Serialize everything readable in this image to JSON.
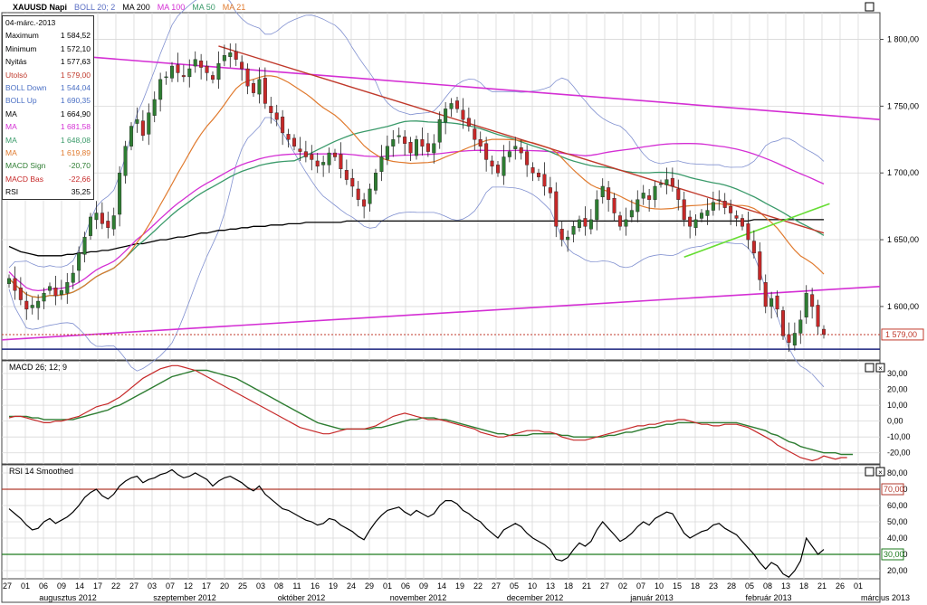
{
  "header": {
    "symbol": "XAUUSD Napi",
    "indicators": [
      {
        "label": "BOLL 20; 2",
        "color": "#5b6fc4"
      },
      {
        "label": "MA 200",
        "color": "#000000"
      },
      {
        "label": "MA 100",
        "color": "#d42fd4"
      },
      {
        "label": "MA 50",
        "color": "#3a9a6a"
      },
      {
        "label": "MA 21",
        "color": "#e07a2e"
      }
    ]
  },
  "info_box": {
    "date": "04-márc.-2013",
    "rows": [
      {
        "label": "Maximum",
        "value": "1 584,52",
        "color": "#000000"
      },
      {
        "label": "Minimum",
        "value": "1 572,10",
        "color": "#000000"
      },
      {
        "label": "Nyitás",
        "value": "1 577,63",
        "color": "#000000"
      },
      {
        "label": "Utolsó",
        "value": "1 579,00",
        "color": "#c0392b"
      },
      {
        "label": "BOLL Down",
        "value": "1 544,04",
        "color": "#4a6fc4"
      },
      {
        "label": "BOLL Up",
        "value": "1 690,35",
        "color": "#4a6fc4"
      },
      {
        "label": "MA",
        "value": "1 664,90",
        "color": "#000000"
      },
      {
        "label": "MA",
        "value": "1 681,58",
        "color": "#d42fd4"
      },
      {
        "label": "MA",
        "value": "1 648,08",
        "color": "#3a9a6a"
      },
      {
        "label": "MA",
        "value": "1 619,89",
        "color": "#e07a2e"
      },
      {
        "label": "MACD Sign",
        "value": "-20,70",
        "color": "#2e7d32"
      },
      {
        "label": "MACD Bas",
        "value": "-22,66",
        "color": "#c62828"
      },
      {
        "label": "RSI",
        "value": "35,25",
        "color": "#000000"
      }
    ]
  },
  "colors": {
    "up": "#2e7d32",
    "down": "#c62828",
    "ma200": "#000000",
    "ma100": "#d42fd4",
    "ma50": "#3a9a6a",
    "ma21": "#e07a2e",
    "boll": "#8090d0",
    "grid": "#d8d8d8",
    "trend_red": "#c0392b",
    "trend_green": "#66dd33",
    "support_blue": "#1a237e",
    "price_dotted": "#c0392b",
    "rsi_level_high": "#b03a2e",
    "rsi_level_low": "#1e7b1e"
  },
  "chart_data": [
    {
      "type": "candlestick",
      "title": "XAUUSD Napi",
      "ylim": [
        1560,
        1820
      ],
      "y_ticks": [
        "1 800,00",
        "1 750,00",
        "1 700,00",
        "1 650,00",
        "1 600,00"
      ],
      "last_price_label": "1 579,00",
      "x_date_labels": [
        "27",
        "01",
        "06",
        "09",
        "14",
        "17",
        "22",
        "27",
        "03",
        "07",
        "12",
        "17",
        "20",
        "25",
        "03",
        "08",
        "11",
        "16",
        "19",
        "24",
        "29",
        "01",
        "06",
        "09",
        "14",
        "19",
        "22",
        "27",
        "05",
        "10",
        "13",
        "18",
        "21",
        "27",
        "02",
        "07",
        "10",
        "15",
        "18",
        "23",
        "28",
        "05",
        "08",
        "13",
        "18",
        "21",
        "26",
        "01"
      ],
      "month_labels": [
        "augusztus 2012",
        "szeptember 2012",
        "október 2012",
        "november 2012",
        "december 2012",
        "január 2013",
        "február 2013",
        "március 2013"
      ],
      "close": [
        1621,
        1612,
        1605,
        1598,
        1601,
        1604,
        1610,
        1615,
        1608,
        1612,
        1618,
        1625,
        1640,
        1652,
        1667,
        1670,
        1662,
        1659,
        1668,
        1700,
        1720,
        1735,
        1740,
        1728,
        1745,
        1755,
        1770,
        1772,
        1780,
        1775,
        1772,
        1778,
        1785,
        1779,
        1775,
        1770,
        1782,
        1788,
        1790,
        1785,
        1778,
        1765,
        1760,
        1770,
        1752,
        1745,
        1740,
        1730,
        1725,
        1720,
        1716,
        1712,
        1710,
        1705,
        1708,
        1715,
        1712,
        1703,
        1695,
        1690,
        1680,
        1675,
        1688,
        1700,
        1712,
        1720,
        1725,
        1728,
        1722,
        1715,
        1725,
        1720,
        1716,
        1722,
        1740,
        1748,
        1752,
        1748,
        1740,
        1735,
        1725,
        1720,
        1710,
        1705,
        1700,
        1712,
        1716,
        1720,
        1715,
        1706,
        1700,
        1697,
        1690,
        1685,
        1660,
        1650,
        1652,
        1660,
        1665,
        1660,
        1665,
        1680,
        1690,
        1680,
        1670,
        1660,
        1665,
        1672,
        1680,
        1685,
        1680,
        1690,
        1692,
        1695,
        1690,
        1680,
        1665,
        1660,
        1665,
        1670,
        1672,
        1678,
        1680,
        1674,
        1670,
        1666,
        1660,
        1650,
        1640,
        1620,
        1600,
        1606,
        1598,
        1578,
        1573,
        1580,
        1590,
        1610,
        1600,
        1585,
        1579
      ],
      "ma200": [
        1645,
        1643,
        1641,
        1640,
        1639,
        1638,
        1638,
        1638,
        1638,
        1638,
        1639,
        1639,
        1640,
        1640,
        1641,
        1641,
        1642,
        1642,
        1643,
        1644,
        1645,
        1646,
        1647,
        1647,
        1648,
        1649,
        1650,
        1650,
        1651,
        1652,
        1652,
        1653,
        1654,
        1655,
        1655,
        1656,
        1657,
        1657,
        1658,
        1658,
        1659,
        1659,
        1660,
        1660,
        1660,
        1661,
        1661,
        1661,
        1662,
        1662,
        1662,
        1663,
        1663,
        1663,
        1663,
        1663,
        1663,
        1663,
        1664,
        1664,
        1664,
        1664,
        1664,
        1664,
        1664,
        1664,
        1664,
        1664,
        1664,
        1664,
        1664,
        1664,
        1664,
        1664,
        1664,
        1664,
        1664,
        1664,
        1664,
        1664,
        1664,
        1664,
        1664,
        1664,
        1664,
        1664,
        1664,
        1664,
        1664,
        1664,
        1664,
        1664,
        1664,
        1664,
        1664,
        1664,
        1664,
        1664,
        1664,
        1664,
        1664,
        1664,
        1664,
        1664,
        1664,
        1664,
        1664,
        1664,
        1664,
        1664,
        1664,
        1664,
        1664,
        1664,
        1664,
        1664,
        1664,
        1664,
        1664,
        1664,
        1664,
        1664,
        1664,
        1664,
        1664,
        1664,
        1664,
        1664,
        1665,
        1665,
        1665,
        1665,
        1665,
        1665,
        1665,
        1665,
        1665,
        1665,
        1665,
        1665,
        1665
      ]
    },
    {
      "type": "line",
      "title": "MACD 26; 12; 9",
      "ylim": [
        -27,
        38
      ],
      "y_ticks": [
        "30,00",
        "20,00",
        "10,00",
        "0,00",
        "-10,00",
        "-20,00"
      ],
      "series": [
        {
          "name": "MACD Bas",
          "values": [
            2,
            3,
            3,
            2,
            1,
            0,
            -1,
            -1,
            0,
            0,
            1,
            2,
            3,
            5,
            7,
            9,
            10,
            11,
            13,
            15,
            18,
            21,
            24,
            27,
            29,
            31,
            33,
            34,
            35,
            35,
            34,
            33,
            32,
            30,
            28,
            26,
            24,
            22,
            20,
            18,
            16,
            14,
            12,
            10,
            8,
            6,
            4,
            2,
            0,
            -2,
            -4,
            -5,
            -6,
            -7,
            -8,
            -8,
            -7,
            -6,
            -5,
            -5,
            -5,
            -5,
            -4,
            -3,
            -1,
            1,
            3,
            4,
            5,
            4,
            3,
            2,
            1,
            1,
            1,
            0,
            -1,
            -2,
            -3,
            -4,
            -5,
            -7,
            -8,
            -9,
            -10,
            -10,
            -9,
            -8,
            -7,
            -6,
            -6,
            -6,
            -7,
            -7,
            -8,
            -10,
            -11,
            -12,
            -12,
            -12,
            -11,
            -10,
            -9,
            -8,
            -7,
            -6,
            -5,
            -4,
            -3,
            -3,
            -2,
            -2,
            -1,
            0,
            0,
            1,
            1,
            0,
            -1,
            -2,
            -2,
            -3,
            -3,
            -2,
            -2,
            -2,
            -3,
            -4,
            -6,
            -8,
            -10,
            -12,
            -15,
            -17,
            -19,
            -21,
            -23,
            -24,
            -25,
            -24,
            -22,
            -23,
            -24,
            -23,
            -23
          ]
        },
        {
          "name": "MACD Sign",
          "values": [
            3,
            3,
            3,
            3,
            2,
            2,
            1,
            1,
            1,
            1,
            1,
            1,
            2,
            3,
            4,
            5,
            6,
            7,
            9,
            10,
            12,
            14,
            16,
            18,
            20,
            22,
            24,
            26,
            28,
            29,
            30,
            31,
            32,
            32,
            32,
            31,
            30,
            29,
            28,
            27,
            25,
            23,
            21,
            19,
            17,
            15,
            13,
            11,
            9,
            7,
            5,
            3,
            1,
            -1,
            -2,
            -3,
            -4,
            -5,
            -5,
            -5,
            -5,
            -5,
            -5,
            -4,
            -4,
            -3,
            -2,
            -1,
            0,
            1,
            1,
            2,
            2,
            2,
            1,
            1,
            0,
            -1,
            -2,
            -3,
            -4,
            -5,
            -6,
            -7,
            -8,
            -8,
            -9,
            -9,
            -9,
            -9,
            -8,
            -8,
            -8,
            -8,
            -8,
            -9,
            -9,
            -10,
            -10,
            -10,
            -10,
            -10,
            -10,
            -9,
            -9,
            -8,
            -7,
            -7,
            -6,
            -5,
            -4,
            -4,
            -3,
            -2,
            -2,
            -1,
            -1,
            -1,
            -1,
            -1,
            -1,
            -1,
            -1,
            -1,
            -1,
            -1,
            -2,
            -3,
            -4,
            -5,
            -6,
            -8,
            -9,
            -11,
            -13,
            -14,
            -16,
            -17,
            -18,
            -19,
            -20,
            -20,
            -20,
            -21,
            -21,
            -21
          ]
        }
      ]
    },
    {
      "type": "line",
      "title": "RSI 14 Smoothed",
      "ylim": [
        15,
        85
      ],
      "y_ticks": [
        "80,00",
        "70,00",
        "60,00",
        "50,00",
        "40,00",
        "30,00",
        "20,00"
      ],
      "levels": [
        "70,00",
        "30,00"
      ],
      "series": [
        {
          "name": "RSI",
          "values": [
            58,
            55,
            52,
            48,
            45,
            46,
            50,
            52,
            49,
            51,
            53,
            56,
            60,
            65,
            68,
            70,
            66,
            64,
            67,
            72,
            75,
            77,
            78,
            74,
            76,
            77,
            79,
            80,
            82,
            79,
            77,
            78,
            80,
            78,
            76,
            72,
            75,
            77,
            78,
            76,
            74,
            71,
            69,
            72,
            67,
            64,
            61,
            58,
            57,
            55,
            53,
            51,
            50,
            48,
            49,
            52,
            51,
            48,
            46,
            44,
            41,
            39,
            45,
            50,
            54,
            57,
            58,
            59,
            56,
            54,
            57,
            55,
            53,
            55,
            60,
            63,
            63,
            61,
            57,
            55,
            52,
            50,
            46,
            43,
            40,
            45,
            47,
            49,
            47,
            43,
            40,
            38,
            36,
            33,
            27,
            26,
            28,
            33,
            37,
            35,
            38,
            45,
            50,
            46,
            42,
            38,
            40,
            43,
            47,
            50,
            48,
            52,
            54,
            56,
            55,
            49,
            43,
            40,
            42,
            44,
            45,
            48,
            49,
            46,
            44,
            42,
            38,
            34,
            30,
            25,
            21,
            25,
            23,
            18,
            16,
            20,
            26,
            40,
            35,
            30,
            33
          ]
        }
      ]
    }
  ]
}
